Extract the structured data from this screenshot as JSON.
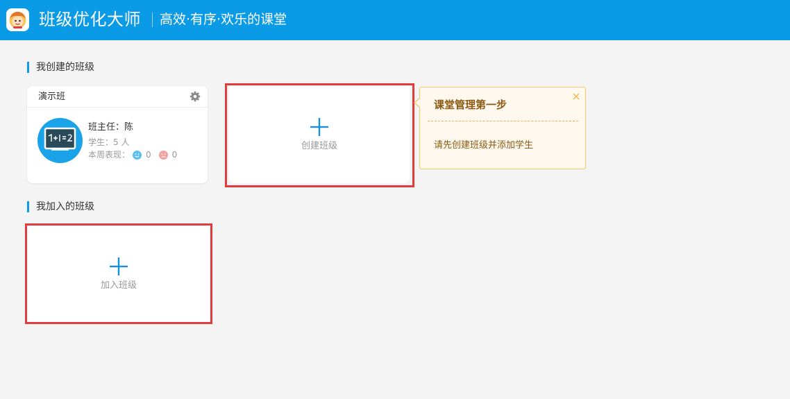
{
  "header": {
    "app_name": "班级优化大师",
    "slogan": "高效·有序·欢乐的课堂",
    "icons": {
      "logo": "app-logo-icon"
    }
  },
  "sections": {
    "created_title": "我创建的班级",
    "joined_title": "我加入的班级"
  },
  "class_card": {
    "name": "演示班",
    "teacher": "班主任：陈",
    "students": "学生：5 人",
    "weekly_label": "本周表现：",
    "positive_count": "0",
    "negative_count": "0",
    "icons": {
      "settings": "gear-icon",
      "avatar": "blackboard-icon",
      "positive": "smile-icon",
      "negative": "sad-icon"
    }
  },
  "create_card": {
    "label": "创建班级",
    "icon": "plus-icon"
  },
  "join_card": {
    "label": "加入班级",
    "icon": "plus-icon"
  },
  "tooltip": {
    "title": "课堂管理第一步",
    "body": "请先创建班级并添加学生",
    "icon": "close-icon"
  },
  "colors": {
    "header_bg": "#0a9ae6",
    "accent": "#0a9ae6",
    "highlight": "#e23b3b",
    "tooltip_bg": "#fff8ef",
    "tooltip_border": "#f5c86a",
    "tooltip_text": "#8a5a12"
  }
}
